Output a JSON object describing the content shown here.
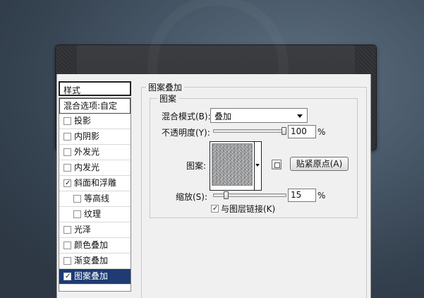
{
  "style_panel": {
    "header": "样式",
    "items": [
      {
        "label": "混合选项:自定",
        "type": "blend",
        "checked": null
      },
      {
        "label": "投影",
        "type": "effect",
        "checked": false
      },
      {
        "label": "内阴影",
        "type": "effect",
        "checked": false
      },
      {
        "label": "外发光",
        "type": "effect",
        "checked": false
      },
      {
        "label": "内发光",
        "type": "effect",
        "checked": false
      },
      {
        "label": "斜面和浮雕",
        "type": "effect",
        "checked": true
      },
      {
        "label": "等高线",
        "type": "sub",
        "checked": false
      },
      {
        "label": "纹理",
        "type": "sub",
        "checked": false
      },
      {
        "label": "光泽",
        "type": "effect",
        "checked": false
      },
      {
        "label": "颜色叠加",
        "type": "effect",
        "checked": false
      },
      {
        "label": "渐变叠加",
        "type": "effect",
        "checked": false
      },
      {
        "label": "图案叠加",
        "type": "effect",
        "checked": true,
        "selected": true
      }
    ]
  },
  "settings": {
    "section_title": "图案叠加",
    "group_title": "图案",
    "blend_mode_label": "混合模式(B):",
    "blend_mode_value": "叠加",
    "opacity_label": "不透明度(Y):",
    "opacity_value": "100",
    "opacity_unit": "%",
    "opacity_level": 1.0,
    "pattern_label": "图案:",
    "snap_button_label": "贴紧原点(A)",
    "scale_label": "缩放(S):",
    "scale_value": "15",
    "scale_unit": "%",
    "scale_level": 0.15,
    "link_label": "与图层链接(K)",
    "link_checked": true
  },
  "colors": {
    "selection": "#1e3b73",
    "dialog_bg": "#f0f0f0"
  },
  "icons": {
    "check": "✓"
  }
}
